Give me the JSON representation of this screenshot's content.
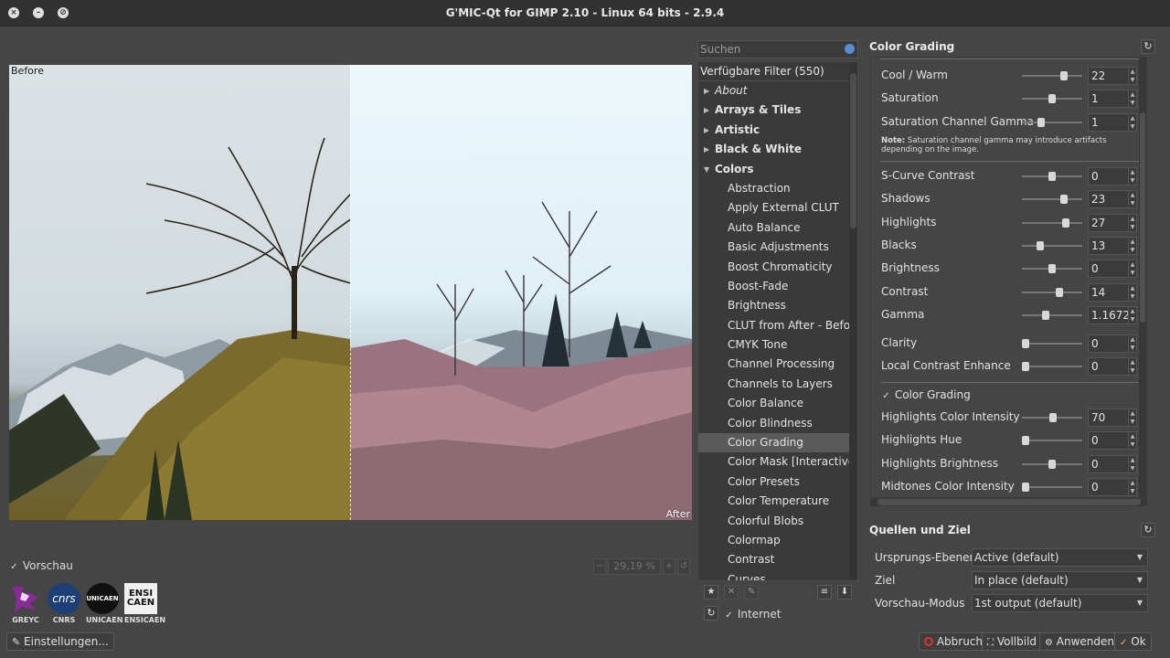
{
  "window": {
    "title": "G'MIC-Qt for GIMP 2.10 - Linux 64 bits - 2.9.4",
    "buttons": [
      "×",
      "–",
      "⊘"
    ]
  },
  "preview": {
    "before_label": "Before",
    "after_label": "After",
    "preview_checkbox": "Vorschau",
    "zoom": "29,19 %"
  },
  "logos": [
    {
      "mark": "",
      "caption": "GREYC",
      "color": "#7a2a8a"
    },
    {
      "mark": "cnrs",
      "caption": "CNRS",
      "color": "#1d3f77"
    },
    {
      "mark": "UNICAEN",
      "caption": "UNICAEN",
      "color": "#111111"
    },
    {
      "mark": "ENSI CAEN",
      "caption": "ENSICAEN",
      "color": "#eeeeee"
    }
  ],
  "settings_button": "Einstellungen...",
  "filters": {
    "search_placeholder": "Suchen",
    "header": "Verfügbare Filter (550)",
    "categories": [
      {
        "label": "About",
        "italic": true
      },
      {
        "label": "Arrays & Tiles"
      },
      {
        "label": "Artistic"
      },
      {
        "label": "Black & White"
      }
    ],
    "open_category": "Colors",
    "items": [
      "Abstraction",
      "Apply External CLUT",
      "Auto Balance",
      "Basic Adjustments",
      "Boost Chromaticity",
      "Boost-Fade",
      "Brightness",
      "CLUT from After - Before",
      "CMYK Tone",
      "Channel Processing",
      "Channels to Layers",
      "Color Balance",
      "Color Blindness",
      "Color Grading",
      "Color Mask [Interactive]",
      "Color Presets",
      "Color Temperature",
      "Colorful Blobs",
      "Colormap",
      "Contrast",
      "Curves"
    ],
    "selected": "Color Grading",
    "internet_label": "Internet"
  },
  "filter_panel": {
    "title": "Color Grading",
    "params_a": [
      {
        "label": "Cool / Warm",
        "value": "22",
        "pos": 0.72
      },
      {
        "label": "Saturation",
        "value": "1",
        "pos": 0.5
      },
      {
        "label": "Saturation Channel Gamma",
        "value": "1",
        "pos": 0.3
      }
    ],
    "note_bold": "Note:",
    "note_text": " Saturation channel gamma may introduce artifacts depending on the image.",
    "params_b": [
      {
        "label": "S-Curve Contrast",
        "value": "0",
        "pos": 0.5
      },
      {
        "label": "Shadows",
        "value": "23",
        "pos": 0.72
      },
      {
        "label": "Highlights",
        "value": "27",
        "pos": 0.75
      },
      {
        "label": "Blacks",
        "value": "13",
        "pos": 0.28
      },
      {
        "label": "Brightness",
        "value": "0",
        "pos": 0.5
      },
      {
        "label": "Contrast",
        "value": "14",
        "pos": 0.63
      },
      {
        "label": "Gamma",
        "value": "1.1672",
        "pos": 0.38
      }
    ],
    "params_c": [
      {
        "label": "Clarity",
        "value": "0",
        "pos": 0.0
      },
      {
        "label": "Local Contrast Enhance",
        "value": "0",
        "pos": 0.0
      }
    ],
    "color_grading_checkbox": "Color Grading",
    "params_d": [
      {
        "label": "Highlights Color Intensity",
        "value": "70",
        "pos": 0.52
      },
      {
        "label": "Highlights Hue",
        "value": "0",
        "pos": 0.0
      },
      {
        "label": "Highlights Brightness",
        "value": "0",
        "pos": 0.5
      },
      {
        "label": "Midtones Color Intensity",
        "value": "0",
        "pos": 0.0
      }
    ]
  },
  "io": {
    "title": "Quellen und Ziel",
    "rows": [
      {
        "label": "Ursprungs-Ebenen",
        "value": "Active (default)"
      },
      {
        "label": "Ziel",
        "value": "In place (default)"
      },
      {
        "label": "Vorschau-Modus",
        "value": "1st output (default)"
      }
    ]
  },
  "actions": {
    "cancel": "Abbruch",
    "fullscreen": "Vollbild",
    "apply": "Anwenden",
    "ok": "Ok"
  }
}
